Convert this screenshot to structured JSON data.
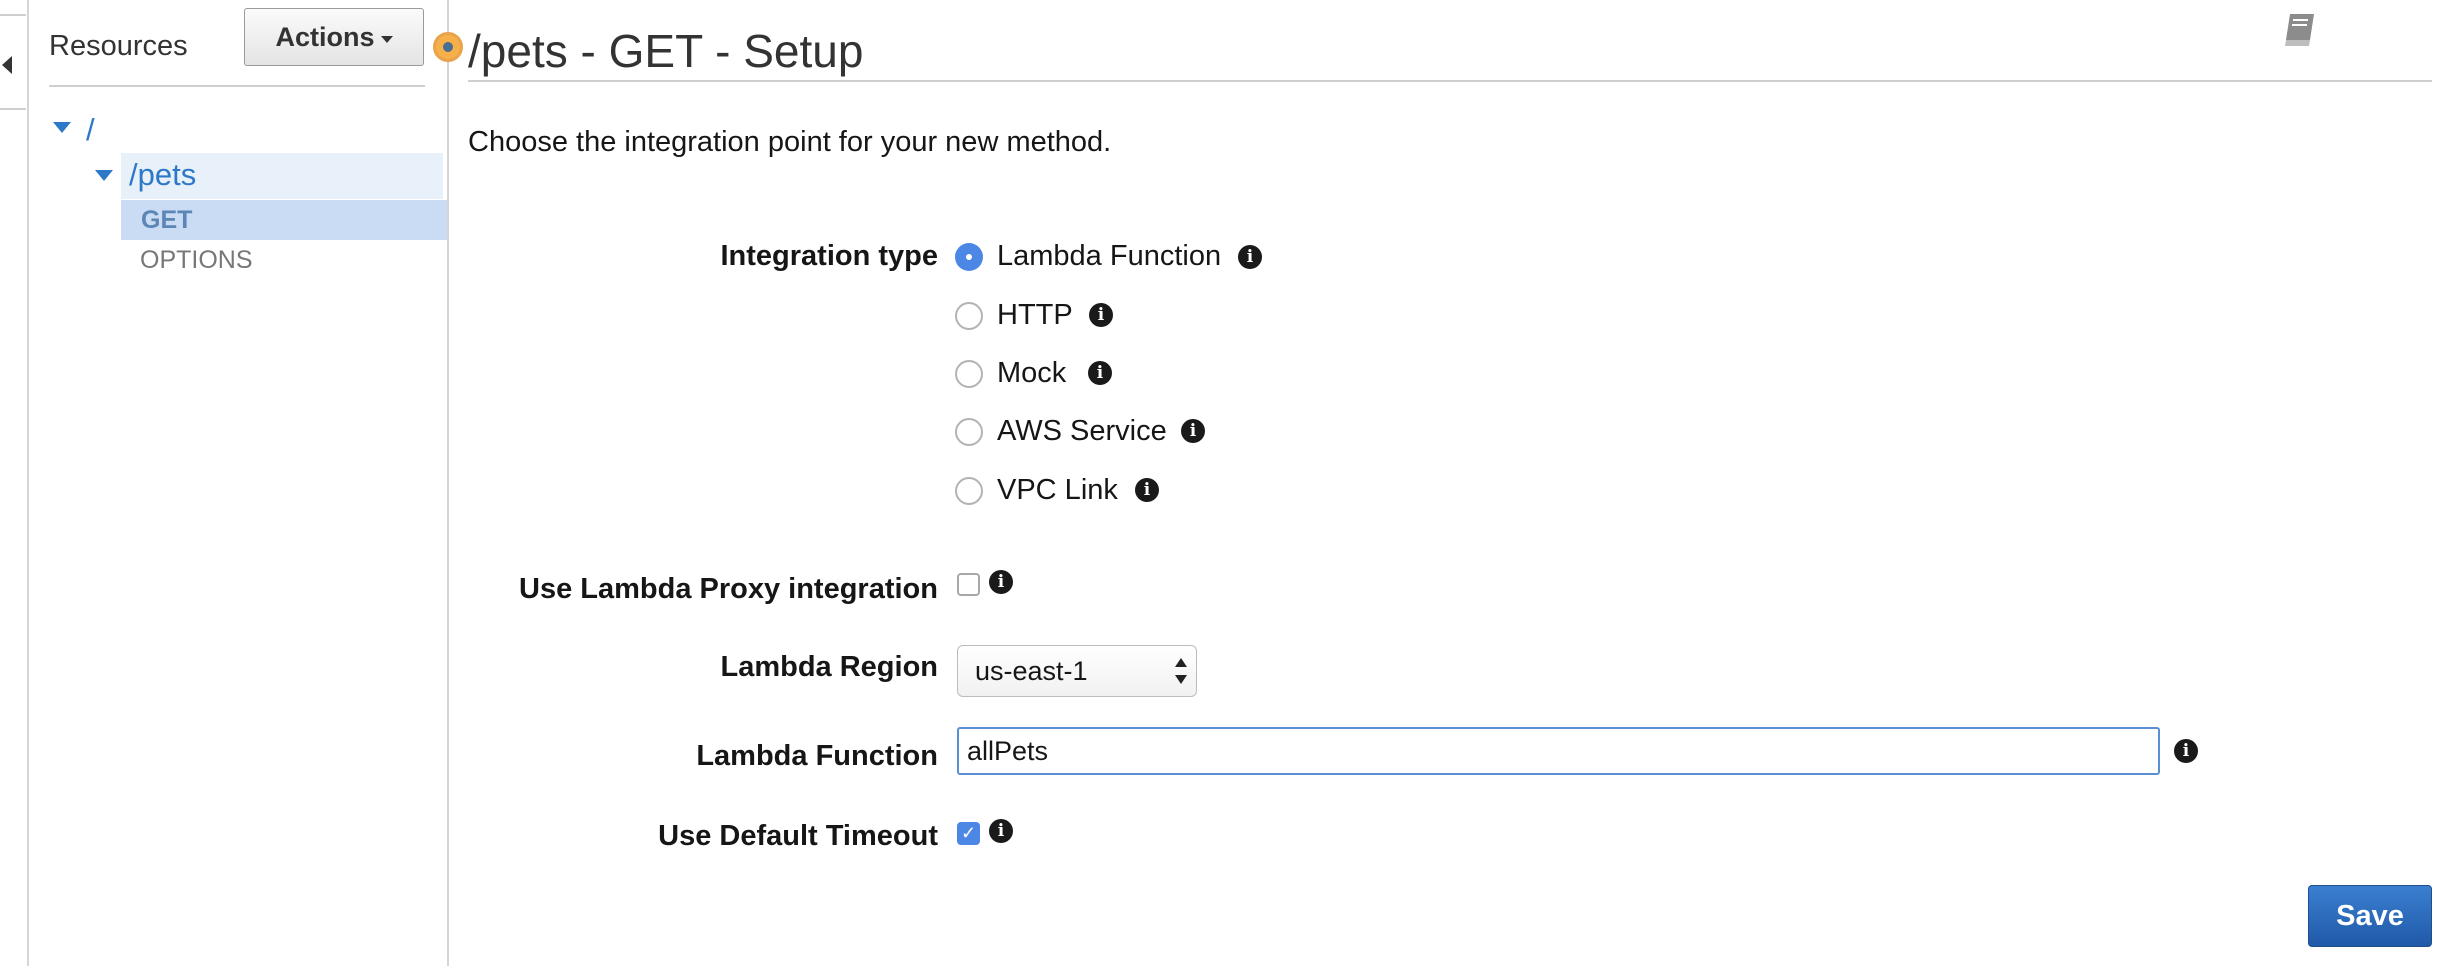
{
  "resources_panel": {
    "title": "Resources",
    "actions_label": "Actions",
    "tree": {
      "root": "/",
      "pets": "/pets",
      "methods": [
        "GET",
        "OPTIONS"
      ]
    }
  },
  "main": {
    "title": "/pets - GET - Setup",
    "intro": "Choose the integration point for your new method.",
    "integration_type": {
      "label": "Integration type",
      "options": [
        "Lambda Function",
        "HTTP",
        "Mock",
        "AWS Service",
        "VPC Link"
      ],
      "selected": "Lambda Function"
    },
    "lambda_proxy": {
      "label": "Use Lambda Proxy integration",
      "checked": false
    },
    "lambda_region": {
      "label": "Lambda Region",
      "value": "us-east-1"
    },
    "lambda_function": {
      "label": "Lambda Function",
      "value": "allPets"
    },
    "default_timeout": {
      "label": "Use Default Timeout",
      "checked": true
    },
    "save_label": "Save"
  },
  "colors": {
    "link_blue": "#2e78c8",
    "selected_row": "#c9dcf4",
    "hover_row": "#e8f0f9",
    "radio_checked": "#4d87e6",
    "save_button": "#2a66b8",
    "status_dot": "#f5b04a"
  },
  "icons": {
    "collapse": "chevron-left-icon",
    "tree_toggle": "caret-down-icon",
    "info": "info-icon",
    "docs": "book-icon",
    "status": "status-dot-icon"
  }
}
